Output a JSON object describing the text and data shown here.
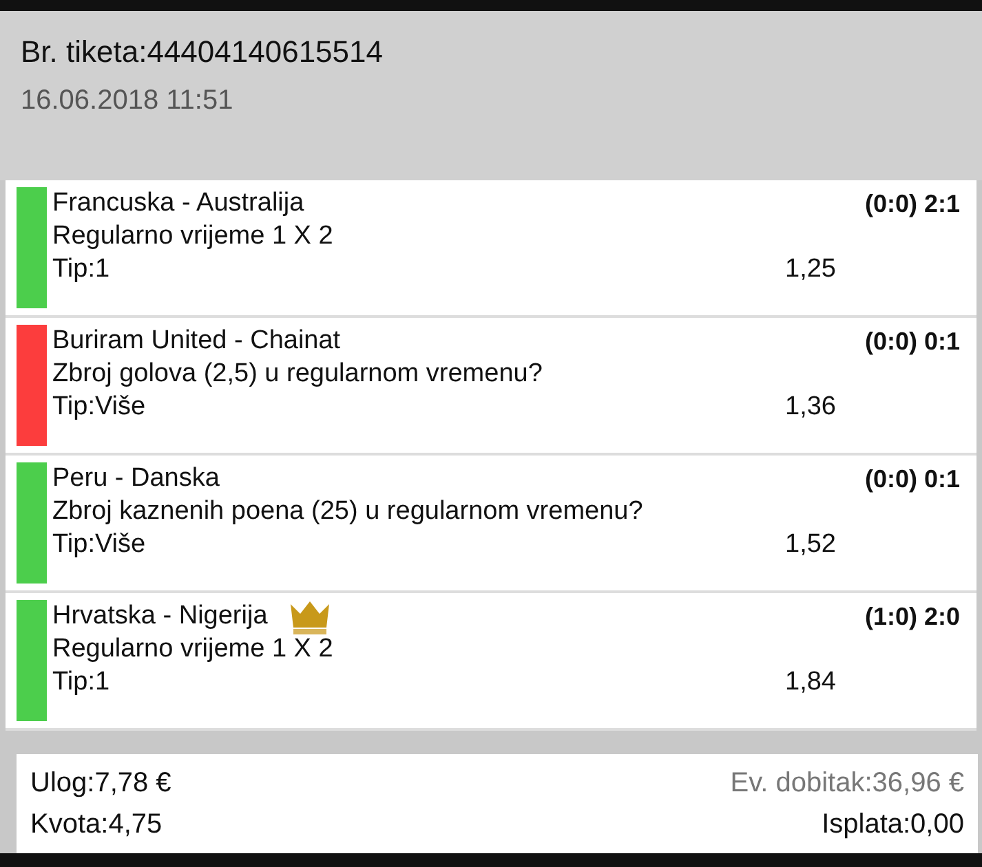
{
  "ticket": {
    "number_label": "Br. tiketa:44404140615514",
    "date": "16.06.2018 11:51"
  },
  "bets": [
    {
      "match": "Francuska - Australija",
      "market": "Regularno vrijeme 1 X 2",
      "tip": "Tip:1",
      "odds": "1,25",
      "score": "(0:0) 2:1",
      "color": "#4cce4c",
      "crown": false
    },
    {
      "match": "Buriram United - Chainat",
      "market": "Zbroj golova (2,5) u regularnom vremenu?",
      "tip": "Tip:Više",
      "odds": "1,36",
      "score": "(0:0) 0:1",
      "color": "#fc3d3d",
      "crown": false
    },
    {
      "match": "Peru - Danska",
      "market": "Zbroj kaznenih poena (25) u regularnom vremenu?",
      "tip": "Tip:Više",
      "odds": "1,52",
      "score": "(0:0) 0:1",
      "color": "#4cce4c",
      "crown": false
    },
    {
      "match": "Hrvatska - Nigerija",
      "market": "Regularno vrijeme 1 X 2",
      "tip": "Tip:1",
      "odds": "1,84",
      "score": "(1:0) 2:0",
      "color": "#4cce4c",
      "crown": true
    }
  ],
  "summary": {
    "stake": "Ulog:7,78 €",
    "possible_win": "Ev. dobitak:36,96 €",
    "total_odds": "Kvota:4,75",
    "payout": "Isplata:0,00"
  }
}
